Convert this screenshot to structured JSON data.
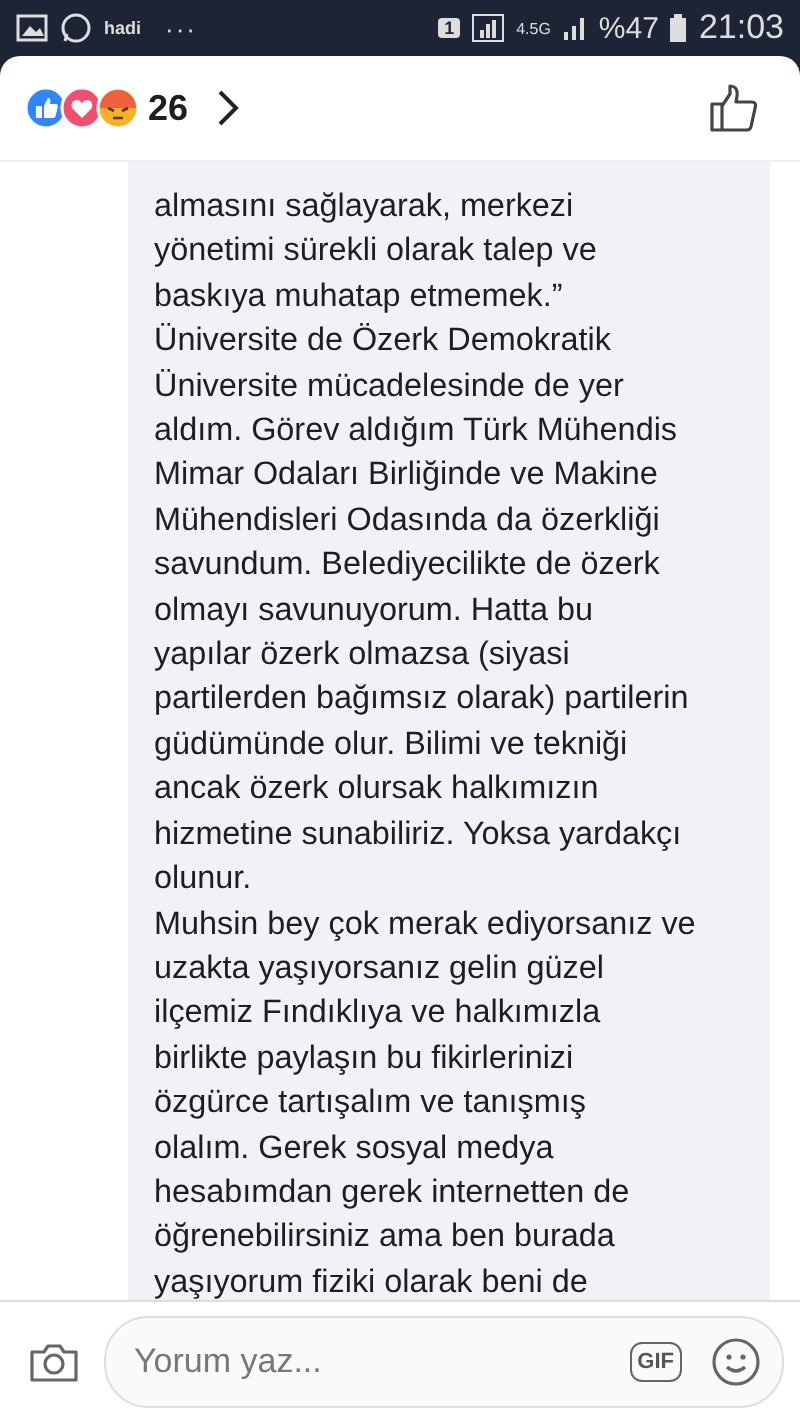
{
  "status_bar": {
    "app_label": "hadi",
    "more": "···",
    "sim": "1",
    "network": "4.5G",
    "battery": "%47",
    "time": "21:03"
  },
  "reactions": {
    "count": "26"
  },
  "comment": {
    "lines": [
      "almasını sağlayarak, merkezi",
      "yönetimi sürekli olarak talep ve",
      "baskıya muhatap etmemek.”",
      "Üniversite de Özerk Demokratik",
      "Üniversite mücadelesinde de yer",
      "aldım. Görev aldığım Türk Mühendis",
      "Mimar Odaları Birliğinde ve Makine",
      "Mühendisleri Odasında da özerkliği",
      "savundum. Belediyecilikte de özerk",
      "olmayı savunuyorum. Hatta bu",
      "yapılar özerk olmazsa (siyasi",
      "partilerden bağımsız olarak) partilerin",
      "güdümünde olur. Bilimi ve tekniği",
      "ancak özerk olursak halkımızın",
      "hizmetine sunabiliriz. Yoksa yardakçı",
      "olunur.",
      "Muhsin bey çok merak ediyorsanız ve",
      "uzakta yaşıyorsanız gelin güzel",
      "ilçemiz Fındıklıya ve halkımızla",
      "birlikte paylaşın bu fikirlerinizi",
      "özgürce tartışalım ve tanışmış",
      "olalım. Gerek sosyal medya",
      "hesabımdan gerek internetten de",
      "öğrenebilirsiniz ama ben burada",
      "yaşıyorum fiziki olarak beni de"
    ]
  },
  "composer": {
    "placeholder": "Yorum yaz...",
    "gif": "GIF"
  }
}
